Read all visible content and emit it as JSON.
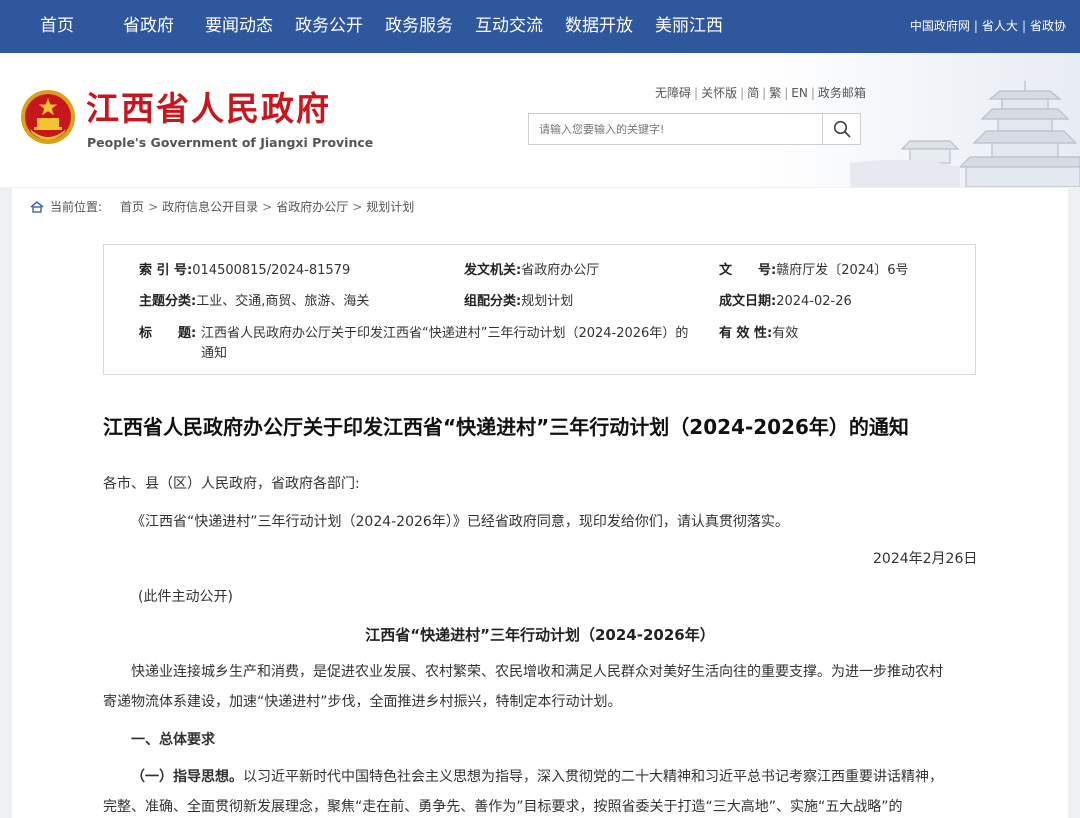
{
  "topnav": {
    "items": [
      "首页",
      "省政府",
      "要闻动态",
      "政务公开",
      "政务服务",
      "互动交流",
      "数据开放",
      "美丽江西"
    ],
    "links": [
      "中国政府网",
      "省人大",
      "省政协"
    ]
  },
  "header": {
    "title": "江西省人民政府",
    "subtitle": "People's Government of Jiangxi Province",
    "util_links": [
      "无障碍",
      "关怀版",
      "简",
      "繁",
      "EN",
      "政务邮箱"
    ],
    "search": {
      "placeholder": "请输入您要输入的关键字!"
    }
  },
  "breadcrumb": {
    "label": "当前位置:",
    "items": [
      "首页",
      "政府信息公开目录",
      "省政府办公厅",
      "规划计划"
    ]
  },
  "meta": {
    "index_label": "索 引 号:",
    "index_value": "014500815/2024-81579",
    "issuer_label": "发文机关:",
    "issuer_value": "省政府办公厅",
    "docno_label": "文　　号:",
    "docno_value": "赣府厅发〔2024〕6号",
    "topic_label": "主题分类:",
    "topic_value": "工业、交通,商贸、旅游、海关",
    "category_label": "组配分类:",
    "category_value": "规划计划",
    "date_label": "成文日期:",
    "date_value": "2024-02-26",
    "title_label": "标　　题:",
    "title_value": "江西省人民政府办公厅关于印发江西省“快递进村”三年行动计划（2024-2026年）的通知",
    "validity_label": "有 效 性:",
    "validity_value": "有效"
  },
  "article": {
    "title": "江西省人民政府办公厅关于印发江西省“快递进村”三年行动计划（2024-2026年）的通知",
    "salutation": "各市、县（区）人民政府，省政府各部门:",
    "intro": "《江西省“快递进村”三年行动计划（2024-2026年）》已经省政府同意，现印发给你们，请认真贯彻落实。",
    "date": "2024年2月26日",
    "disclosure": "(此件主动公开)",
    "plan_title": "江西省“快递进村”三年行动计划（2024-2026年）",
    "para1_line1": "快递业连接城乡生产和消费，是促进农业发展、农村繁荣、农民增收和满足人民群众对美好生活向往的重要支撑。为进一步推动农村",
    "para1_line2": "寄递物流体系建设，加速“快递进村”步伐，全面推进乡村振兴，特制定本行动计划。",
    "section1": "一、总体要求",
    "sub1_label": "（一）指导思想。",
    "sub1_line1": "以习近平新时代中国特色社会主义思想为指导，深入贯彻党的二十大精神和习近平总书记考察江西重要讲话精神，",
    "sub1_line2": "完整、准确、全面贯彻新发展理念，聚焦“走在前、勇争先、善作为”目标要求，按照省委关于打造“三大高地”、实施“五大战略”的"
  },
  "colors": {
    "nav": "#2f579e",
    "brand_red": "#c8161d"
  }
}
